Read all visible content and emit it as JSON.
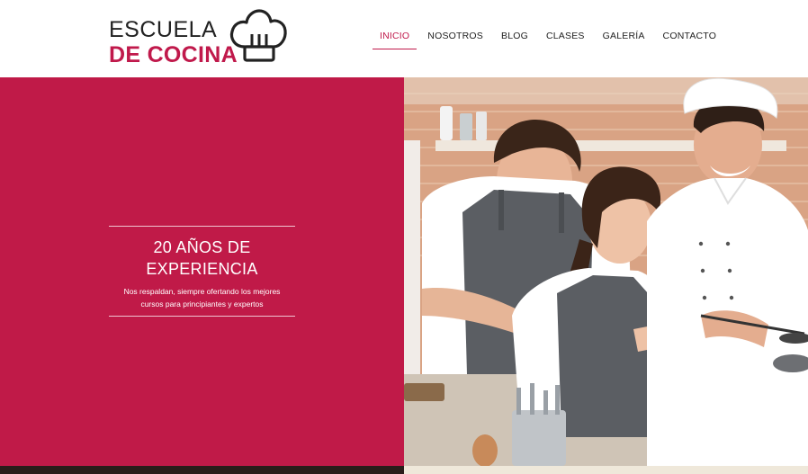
{
  "logo": {
    "line1": "ESCUELA",
    "line2": "DE COCINA",
    "icon": "chef-hat-icon"
  },
  "nav": {
    "items": [
      {
        "label": "INICIO",
        "active": true
      },
      {
        "label": "NOSOTROS",
        "active": false
      },
      {
        "label": "BLOG",
        "active": false
      },
      {
        "label": "CLASES",
        "active": false
      },
      {
        "label": "GALERÍA",
        "active": false
      },
      {
        "label": "CONTACTO",
        "active": false
      }
    ]
  },
  "hero": {
    "title_line1": "20 AÑOS DE",
    "title_line2": "EXPERIENCIA",
    "subtitle": "Nos respaldan, siempre ofertando los mejores cursos para principiantes y expertos",
    "image": "cooking-class-photo"
  },
  "colors": {
    "brand": "#c01a48",
    "text": "#222222",
    "white": "#ffffff"
  }
}
